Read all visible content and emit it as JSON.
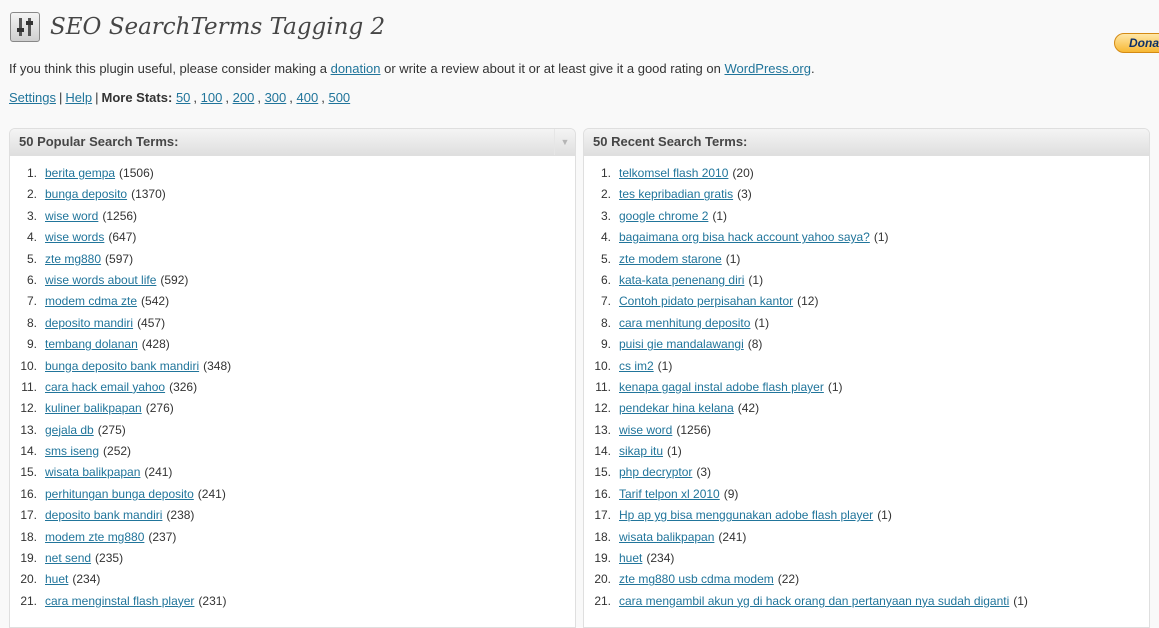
{
  "header": {
    "title": "SEO SearchTerms Tagging 2",
    "donate_label": "Dona"
  },
  "intro": {
    "before": "If you think this plugin useful, please consider making a",
    "donation_link": "donation",
    "middle": "or write a review about it or at least give it a good rating on",
    "wp_link": "WordPress.org",
    "after": "."
  },
  "nav": {
    "settings": "Settings",
    "help": "Help",
    "more_stats_label": "More Stats:",
    "stats": [
      "50",
      "100",
      "200",
      "300",
      "400",
      "500"
    ]
  },
  "popular": {
    "title": "50 Popular Search Terms:",
    "items": [
      {
        "n": "1.",
        "term": "berita gempa",
        "count": "(1506)"
      },
      {
        "n": "2.",
        "term": "bunga deposito",
        "count": "(1370)"
      },
      {
        "n": "3.",
        "term": "wise word",
        "count": "(1256)"
      },
      {
        "n": "4.",
        "term": "wise words",
        "count": "(647)"
      },
      {
        "n": "5.",
        "term": "zte mg880",
        "count": "(597)"
      },
      {
        "n": "6.",
        "term": "wise words about life",
        "count": "(592)"
      },
      {
        "n": "7.",
        "term": "modem cdma zte",
        "count": "(542)"
      },
      {
        "n": "8.",
        "term": "deposito mandiri",
        "count": "(457)"
      },
      {
        "n": "9.",
        "term": "tembang dolanan",
        "count": "(428)"
      },
      {
        "n": "10.",
        "term": "bunga deposito bank mandiri",
        "count": "(348)"
      },
      {
        "n": "11.",
        "term": "cara hack email yahoo",
        "count": "(326)"
      },
      {
        "n": "12.",
        "term": "kuliner balikpapan",
        "count": "(276)"
      },
      {
        "n": "13.",
        "term": "gejala db",
        "count": "(275)"
      },
      {
        "n": "14.",
        "term": "sms iseng",
        "count": "(252)"
      },
      {
        "n": "15.",
        "term": "wisata balikpapan",
        "count": "(241)"
      },
      {
        "n": "16.",
        "term": "perhitungan bunga deposito",
        "count": "(241)"
      },
      {
        "n": "17.",
        "term": "deposito bank mandiri",
        "count": "(238)"
      },
      {
        "n": "18.",
        "term": "modem zte mg880",
        "count": "(237)"
      },
      {
        "n": "19.",
        "term": "net send",
        "count": "(235)"
      },
      {
        "n": "20.",
        "term": "huet",
        "count": "(234)"
      },
      {
        "n": "21.",
        "term": "cara menginstal flash player",
        "count": "(231)"
      }
    ]
  },
  "recent": {
    "title": "50 Recent Search Terms:",
    "items": [
      {
        "n": "1.",
        "term": "telkomsel flash 2010",
        "count": "(20)"
      },
      {
        "n": "2.",
        "term": "tes kepribadian gratis",
        "count": "(3)"
      },
      {
        "n": "3.",
        "term": "google chrome 2",
        "count": "(1)"
      },
      {
        "n": "4.",
        "term": "bagaimana org bisa hack account yahoo saya?",
        "count": "(1)"
      },
      {
        "n": "5.",
        "term": "zte modem starone",
        "count": "(1)"
      },
      {
        "n": "6.",
        "term": "kata-kata penenang diri",
        "count": "(1)"
      },
      {
        "n": "7.",
        "term": "Contoh pidato perpisahan kantor",
        "count": "(12)"
      },
      {
        "n": "8.",
        "term": "cara menhitung deposito",
        "count": "(1)"
      },
      {
        "n": "9.",
        "term": "puisi gie mandalawangi",
        "count": "(8)"
      },
      {
        "n": "10.",
        "term": "cs im2",
        "count": "(1)"
      },
      {
        "n": "11.",
        "term": "kenapa gagal instal adobe flash player",
        "count": "(1)"
      },
      {
        "n": "12.",
        "term": "pendekar hina kelana",
        "count": "(42)"
      },
      {
        "n": "13.",
        "term": "wise word",
        "count": "(1256)"
      },
      {
        "n": "14.",
        "term": "sikap itu",
        "count": "(1)"
      },
      {
        "n": "15.",
        "term": "php decryptor",
        "count": "(3)"
      },
      {
        "n": "16.",
        "term": "Tarif telpon xl 2010",
        "count": "(9)"
      },
      {
        "n": "17.",
        "term": "Hp ap yg bisa menggunakan adobe flash player",
        "count": "(1)"
      },
      {
        "n": "18.",
        "term": "wisata balikpapan",
        "count": "(241)"
      },
      {
        "n": "19.",
        "term": "huet",
        "count": "(234)"
      },
      {
        "n": "20.",
        "term": "zte mg880 usb cdma modem",
        "count": "(22)"
      },
      {
        "n": "21.",
        "term": "cara mengambil akun yg di hack orang dan pertanyaan nya sudah diganti",
        "count": "(1)"
      }
    ]
  }
}
